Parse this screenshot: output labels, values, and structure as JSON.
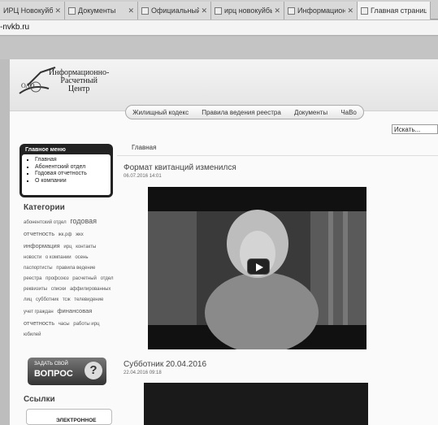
{
  "browser": {
    "tabs": [
      {
        "title": "ИРЦ Новокуйбышев"
      },
      {
        "title": "Документы"
      },
      {
        "title": "Официальный сайт"
      },
      {
        "title": "ирц новокуйбышев"
      },
      {
        "title": "Информационно-р"
      },
      {
        "title": "Главная страница"
      }
    ],
    "address": "-nvkb.ru"
  },
  "header": {
    "logo_line1": "Информационно-",
    "logo_line2": "Расчетный",
    "logo_line3": "Центр",
    "logo_prefix": "ОАО",
    "nav": [
      "Жилищный кодекс",
      "Правила ведения реестра",
      "Документы",
      "ЧаВо"
    ],
    "search_placeholder": "Искать..."
  },
  "breadcrumb": "Главная",
  "main_menu": {
    "title": "Главное меню",
    "items": [
      "Главная",
      "Абонентский отдел",
      "Годовая отчетность",
      "О компании"
    ]
  },
  "categories": {
    "title": "Категории",
    "tags": [
      {
        "text": "абонентский отдел",
        "size": "s"
      },
      {
        "text": "годовая",
        "size": "b"
      },
      {
        "text": "отчетность",
        "size": "m"
      },
      {
        "text": "жк.рф",
        "size": "s"
      },
      {
        "text": "жкх",
        "size": "s"
      },
      {
        "text": "информация",
        "size": "m"
      },
      {
        "text": "ирц",
        "size": "s"
      },
      {
        "text": "контакты",
        "size": "s"
      },
      {
        "text": "новости",
        "size": "s"
      },
      {
        "text": "о компании",
        "size": "s"
      },
      {
        "text": "осень",
        "size": "s"
      },
      {
        "text": "паспортисты",
        "size": "s"
      },
      {
        "text": "правила ведение",
        "size": "s"
      },
      {
        "text": "реестра",
        "size": "s"
      },
      {
        "text": "профсоюз",
        "size": "s"
      },
      {
        "text": "расчетный",
        "size": "s"
      },
      {
        "text": "отдел",
        "size": "s"
      },
      {
        "text": "реквизиты",
        "size": "s"
      },
      {
        "text": "списки",
        "size": "s"
      },
      {
        "text": "аффилированных лиц",
        "size": "s"
      },
      {
        "text": "субботник",
        "size": "s"
      },
      {
        "text": "тсж",
        "size": "s"
      },
      {
        "text": "телевидение",
        "size": "s"
      },
      {
        "text": "учет граждан",
        "size": "s"
      },
      {
        "text": "финансовая отчетность",
        "size": "m"
      },
      {
        "text": "часы",
        "size": "s"
      },
      {
        "text": "работы ирц",
        "size": "s"
      },
      {
        "text": "юбилей",
        "size": "s"
      }
    ]
  },
  "ask_button": {
    "line1": "ЗАДАТЬ СВОЙ",
    "line2": "ВОПРОС",
    "icon": "?"
  },
  "links": {
    "title": "Ссылки",
    "item": "ЭЛЕКТРОННОЕ"
  },
  "articles": [
    {
      "title": "Формат квитанций изменился",
      "date": "06.07.2016 14:01"
    },
    {
      "title": "Субботник 20.04.2016",
      "date": "22.04.2016 09:18"
    }
  ]
}
